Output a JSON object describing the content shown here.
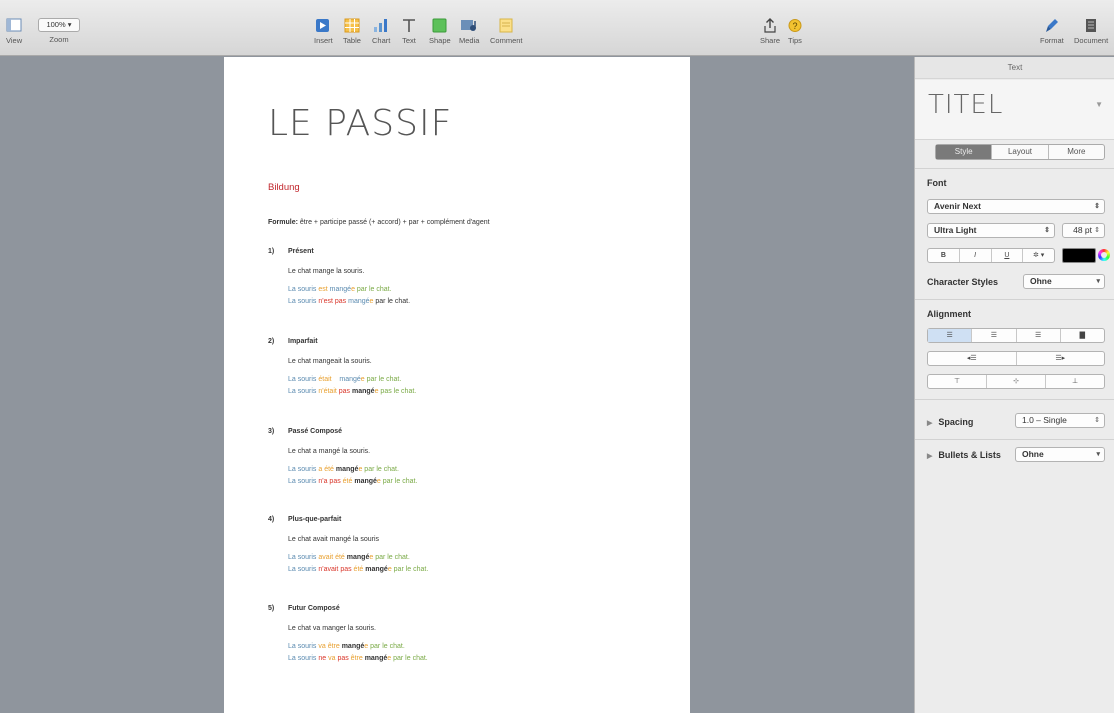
{
  "toolbar": {
    "view_label": "View",
    "zoom_value": "100%",
    "zoom_label": "Zoom",
    "insert_label": "Insert",
    "table_label": "Table",
    "chart_label": "Chart",
    "text_label": "Text",
    "shape_label": "Shape",
    "media_label": "Media",
    "comment_label": "Comment",
    "share_label": "Share",
    "tips_label": "Tips",
    "format_label": "Format",
    "document_label": "Document"
  },
  "document": {
    "title": "LE PASSIF",
    "subtitle": "Bildung",
    "formula_label": "Formule:",
    "formula_text": " être + participe passé (+ accord) + par + complément d'agent",
    "sections": [
      {
        "num": "1)",
        "heading": "Présent",
        "sentence": "Le chat mange la souris.",
        "line1": [
          [
            "La souris ",
            "blue"
          ],
          [
            "est",
            "orange"
          ],
          [
            " mangé",
            "blue"
          ],
          [
            "e",
            "orange"
          ],
          [
            " par le chat.",
            "green"
          ]
        ],
        "line2": [
          [
            "La souris ",
            "blue"
          ],
          [
            "n'est pas",
            "red"
          ],
          [
            " mangé",
            "blue"
          ],
          [
            "e",
            "orange"
          ],
          [
            " par le chat.",
            "plain"
          ]
        ]
      },
      {
        "num": "2)",
        "heading": "Imparfait",
        "sentence": "Le chat mangeait la souris.",
        "line1": [
          [
            "La souris ",
            "blue"
          ],
          [
            "était",
            "orange"
          ],
          [
            "    mangé",
            "blue"
          ],
          [
            "e",
            "orange"
          ],
          [
            " par le chat.",
            "green"
          ]
        ],
        "line2": [
          [
            "La souris ",
            "blue"
          ],
          [
            "n'était",
            "orange"
          ],
          [
            " pas",
            "red"
          ],
          [
            " mangé",
            "dark"
          ],
          [
            "e",
            "orange"
          ],
          [
            " pas le chat.",
            "green"
          ]
        ]
      },
      {
        "num": "3)",
        "heading": "Passé Composé",
        "sentence": "Le chat a mangé la souris.",
        "line1": [
          [
            "La souris ",
            "blue"
          ],
          [
            "a été",
            "orange"
          ],
          [
            " mangé",
            "dark"
          ],
          [
            "e",
            "orange"
          ],
          [
            " par le chat.",
            "green"
          ]
        ],
        "line2": [
          [
            "La souris ",
            "blue"
          ],
          [
            "n'a pas",
            "red"
          ],
          [
            " été",
            "orange"
          ],
          [
            " mangé",
            "dark"
          ],
          [
            "e",
            "orange"
          ],
          [
            " par le chat.",
            "green"
          ]
        ]
      },
      {
        "num": "4)",
        "heading": "Plus-que-parfait",
        "sentence": "Le chat avait mangé la souris",
        "line1": [
          [
            "La souris ",
            "blue"
          ],
          [
            "avait été",
            "orange"
          ],
          [
            " mangé",
            "dark"
          ],
          [
            "e",
            "orange"
          ],
          [
            " par le chat.",
            "green"
          ]
        ],
        "line2": [
          [
            "La souris ",
            "blue"
          ],
          [
            "n'avait pas",
            "red"
          ],
          [
            " été",
            "orange"
          ],
          [
            " mangé",
            "dark"
          ],
          [
            "e",
            "orange"
          ],
          [
            " par le chat.",
            "green"
          ]
        ]
      },
      {
        "num": "5)",
        "heading": "Futur Composé",
        "sentence": "Le chat va manger la souris.",
        "line1": [
          [
            "La souris ",
            "blue"
          ],
          [
            "va être",
            "orange"
          ],
          [
            " mangé",
            "dark"
          ],
          [
            "e",
            "orange"
          ],
          [
            " par le chat.",
            "green"
          ]
        ],
        "line2": [
          [
            "La souris ",
            "blue"
          ],
          [
            "ne",
            "red"
          ],
          [
            " va",
            "orange"
          ],
          [
            " pas",
            "red"
          ],
          [
            " être",
            "orange"
          ],
          [
            " mangé",
            "dark"
          ],
          [
            "e",
            "orange"
          ],
          [
            " par le chat.",
            "green"
          ]
        ]
      }
    ]
  },
  "inspector": {
    "header": "Text",
    "paragraph_style": "TITEL",
    "tabs": [
      "Style",
      "Layout",
      "More"
    ],
    "active_tab": "Style",
    "font_section": "Font",
    "font_family": "Avenir Next",
    "font_weight": "Ultra Light",
    "font_size": "48 pt",
    "bold": "B",
    "italic": "I",
    "underline": "U",
    "gear": "✲ ▾",
    "char_styles_label": "Character Styles",
    "char_styles_value": "Ohne",
    "alignment_section": "Alignment",
    "spacing_label": "Spacing",
    "spacing_value": "1.0 – Single",
    "bullets_label": "Bullets & Lists",
    "bullets_value": "Ohne",
    "text_color": "#000000"
  }
}
